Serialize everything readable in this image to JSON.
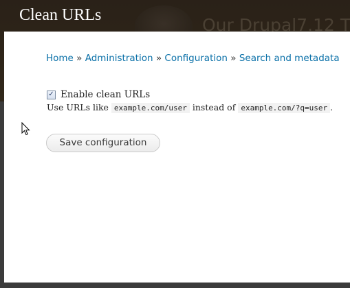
{
  "overlay": {
    "title": "Clean URLs"
  },
  "background": {
    "site_name": "Our Drupal7.12 T"
  },
  "breadcrumb": {
    "items": [
      "Home",
      "Administration",
      "Configuration",
      "Search and metadata"
    ],
    "separator": "»"
  },
  "form": {
    "clean_urls_checkbox": {
      "label": "Enable clean URLs",
      "checked": true,
      "check_glyph": "✓"
    },
    "description": {
      "prefix": "Use URLs like",
      "example_clean": "example.com/user",
      "middle": "instead of",
      "example_dirty": "example.com/?q=user",
      "suffix": "."
    },
    "save_label": "Save configuration"
  },
  "colors": {
    "link": "#0a70a8",
    "header_bg": "#2e2519",
    "panel_bg": "#ffffff"
  },
  "icons": [
    "mouse-pointer-icon",
    "checkbox-checked-icon"
  ]
}
